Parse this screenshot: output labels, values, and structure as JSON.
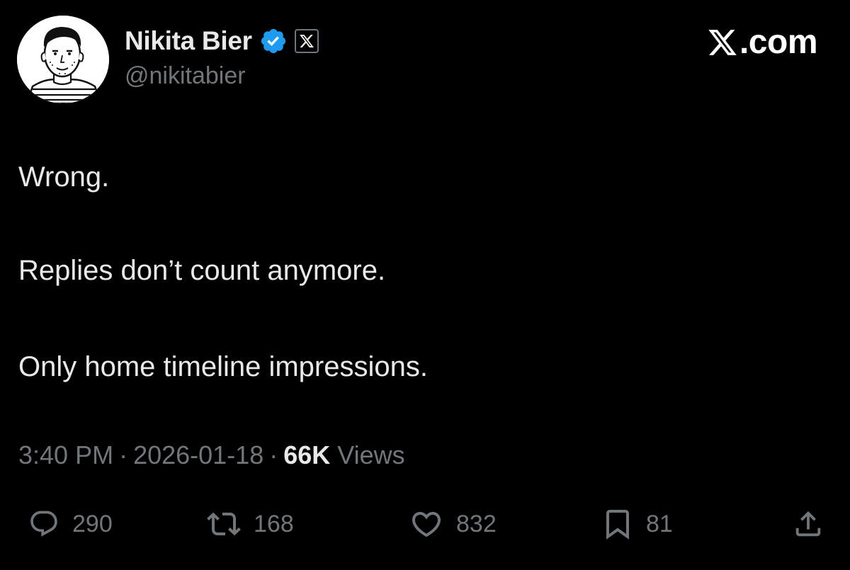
{
  "author": {
    "display_name": "Nikita Bier",
    "handle": "@nikitabier",
    "verified_icon": "verified-badge-icon",
    "affiliate_icon": "x-affiliate-icon"
  },
  "brand": {
    "text": "X.com",
    "icon": "x-logo-icon"
  },
  "tweet": {
    "lines": [
      "Wrong.",
      "Replies don’t count anymore.",
      "Only home timeline impressions."
    ]
  },
  "meta": {
    "time": "3:40 PM",
    "separator": "·",
    "date": "2026-01-18",
    "views_count": "66K",
    "views_label": "Views"
  },
  "actions": {
    "reply": {
      "icon": "reply-icon",
      "count": "290"
    },
    "repost": {
      "icon": "repost-icon",
      "count": "168"
    },
    "like": {
      "icon": "heart-icon",
      "count": "832"
    },
    "bookmark": {
      "icon": "bookmark-icon",
      "count": "81"
    },
    "share": {
      "icon": "share-icon"
    }
  },
  "colors": {
    "background": "#000000",
    "text_primary": "#e7e9ea",
    "text_secondary": "#71767b",
    "verified_blue": "#1d9bf0"
  }
}
